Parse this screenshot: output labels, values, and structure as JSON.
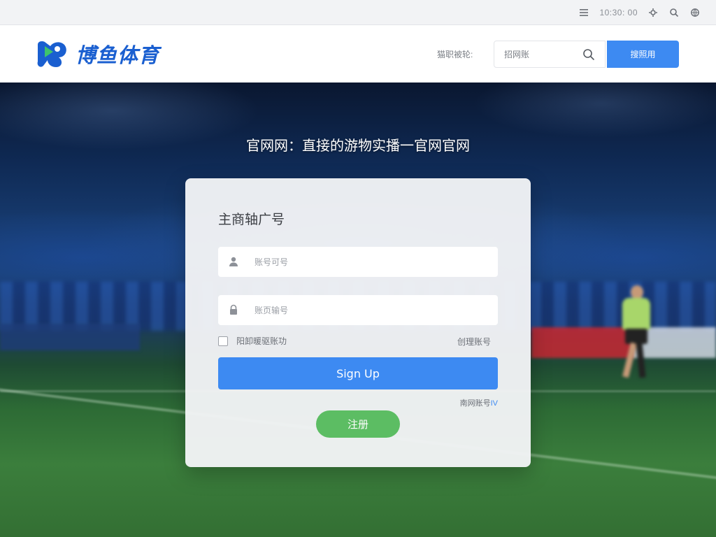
{
  "utility_bar": {
    "time_text": "10:30: 00",
    "icons": [
      "menu-icon",
      "settings-icon",
      "search-icon",
      "globe-icon"
    ]
  },
  "header": {
    "logo_text": "博鱼体育",
    "label": "猫职被轮:",
    "search_placeholder": "招网账",
    "button_label": "搜照用"
  },
  "hero": {
    "title": "官网网：直接的游物实播一官网官网"
  },
  "login": {
    "title": "主商轴广号",
    "username_placeholder": "账号可号",
    "password_placeholder": "账页输号",
    "remember_label": "阳卸暖驱账功",
    "forgot_label": "创理账号",
    "signup_label": "Sign Up",
    "help_text": "南网账号",
    "help_accent": "IV",
    "register_label": "注册"
  },
  "colors": {
    "primary_blue": "#3d8af2",
    "register_green": "#5cbd63",
    "logo_blue": "#1a5fd0"
  }
}
